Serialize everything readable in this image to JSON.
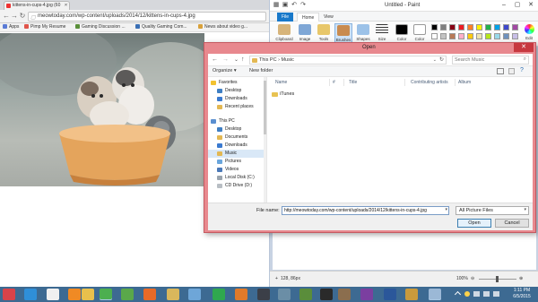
{
  "chrome": {
    "tab_title": "kittens-in-cups-4.jpg (60",
    "url": "meowtoday.com/wp-content/uploads/2014/12/kittens-in-cups-4.jpg",
    "bookmarks": [
      {
        "label": "Apps",
        "color": "#5b7bd5"
      },
      {
        "label": "Pimp My Resume",
        "color": "#e0544a"
      },
      {
        "label": "Gaming Discussion ...",
        "color": "#5a8f3a"
      },
      {
        "label": "Quality Gaming Com...",
        "color": "#3a6fb5"
      },
      {
        "label": "News about video g...",
        "color": "#d9a13a"
      }
    ]
  },
  "paint": {
    "title": "Untitled - Paint",
    "tabs": {
      "file": "File",
      "home": "Home",
      "view": "View"
    },
    "ribbon": {
      "clipboard": "Clipboard",
      "image": "Image",
      "tools": "Tools",
      "brushes": "Brushes",
      "shapes": "Shapes",
      "size": "Size",
      "color1": "Color",
      "color2": "Color",
      "edit_colors": "Edit"
    },
    "palette_top": [
      "#000000",
      "#7f7f7f",
      "#880015",
      "#ed1c24",
      "#ff7f27",
      "#fff200",
      "#22b14c",
      "#00a2e8",
      "#3f48cc",
      "#a349a4"
    ],
    "palette_bottom": [
      "#ffffff",
      "#c3c3c3",
      "#b97a57",
      "#ffaec9",
      "#ffc90e",
      "#efe4b0",
      "#b5e61d",
      "#99d9ea",
      "#7092be",
      "#c8bfe7"
    ],
    "status": {
      "position": "128, 86px",
      "zoom": "100%"
    }
  },
  "dialog": {
    "title": "Open",
    "close": "✕",
    "path": {
      "this_pc": "This PC",
      "sep": "›",
      "folder": "Music"
    },
    "search_placeholder": "Search Music",
    "organize": "Organize ▾",
    "new_folder": "New folder",
    "nav": {
      "favorites": "Favorites",
      "desktop": "Desktop",
      "downloads": "Downloads",
      "recent": "Recent places",
      "this_pc": "This PC",
      "pc_desktop": "Desktop",
      "documents": "Documents",
      "pc_downloads": "Downloads",
      "music": "Music",
      "pictures": "Pictures",
      "videos": "Videos",
      "local_disk": "Local Disk (C:)",
      "cd_drive": "CD Drive (D:)"
    },
    "columns": {
      "name": "Name",
      "number": "#",
      "title": "Title",
      "artists": "Contributing artists",
      "album": "Album"
    },
    "items": [
      "iTunes"
    ],
    "file_name_label": "File name:",
    "file_name_value": "http://meowtoday.com/wp-content/uploads/2014/12/kittens-in-cups-4.jpg",
    "filter": "All Picture Files",
    "open_button": "Open",
    "cancel_button": "Cancel"
  },
  "taskbar": {
    "time": "1:11 PM",
    "date": "6/5/2015"
  }
}
